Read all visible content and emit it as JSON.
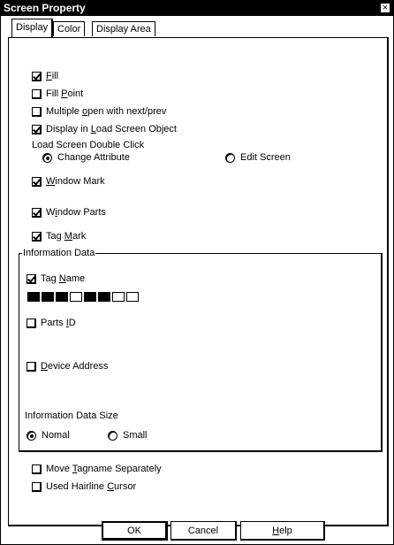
{
  "window": {
    "title": "Screen Property",
    "close_glyph": "×"
  },
  "tabs": [
    {
      "label": "Display",
      "active": true
    },
    {
      "label": "Color",
      "active": false
    },
    {
      "label": "Display Area",
      "active": false
    }
  ],
  "display": {
    "fill": {
      "pre": "",
      "key": "F",
      "post": "ill",
      "checked": true
    },
    "fill_point": {
      "pre": "Fill ",
      "key": "P",
      "post": "oint",
      "checked": false
    },
    "multiple_open": {
      "pre": "Multiple ",
      "key": "o",
      "post": "pen with next/prev",
      "checked": false
    },
    "display_in_load": {
      "pre": "Display in ",
      "key": "L",
      "post": "oad Screen Object",
      "checked": true
    },
    "load_screen_label": "Load Screen Double Click",
    "change_attribute": {
      "label": "Change Attribute",
      "selected": true
    },
    "edit_screen": {
      "label": "Edit Screen",
      "selected": false
    },
    "window_mark": {
      "pre": "",
      "key": "W",
      "post": "indow Mark",
      "checked": true
    },
    "window_parts": {
      "pre": "W",
      "key": "i",
      "post": "ndow Parts",
      "checked": true
    },
    "tag_mark": {
      "pre": "Tag ",
      "key": "M",
      "post": "ark",
      "checked": true
    }
  },
  "information_data": {
    "title": "Information Data",
    "tag_name": {
      "pre": "Tag ",
      "key": "N",
      "post": "ame",
      "checked": true
    },
    "swatches": [
      "black",
      "black",
      "black",
      "white",
      "black",
      "black",
      "white",
      "white"
    ],
    "parts_id": {
      "pre": "Parts ",
      "key": "I",
      "post": "D",
      "checked": false
    },
    "device_address": {
      "pre": "",
      "key": "D",
      "post": "evice Address",
      "checked": false
    },
    "size_label": "Information Data Size",
    "normal": {
      "label": "Nomal",
      "selected": true
    },
    "small": {
      "label": "Small",
      "selected": false
    }
  },
  "bottom": {
    "move_tagname": {
      "pre": "Move ",
      "key": "T",
      "post": "agname Separately",
      "checked": false
    },
    "hairline": {
      "pre": "Used Hairline ",
      "key": "C",
      "post": "ursor",
      "checked": false
    }
  },
  "buttons": {
    "ok": "OK",
    "cancel": "Cancel",
    "help": {
      "pre": "",
      "key": "H",
      "post": "elp"
    }
  }
}
